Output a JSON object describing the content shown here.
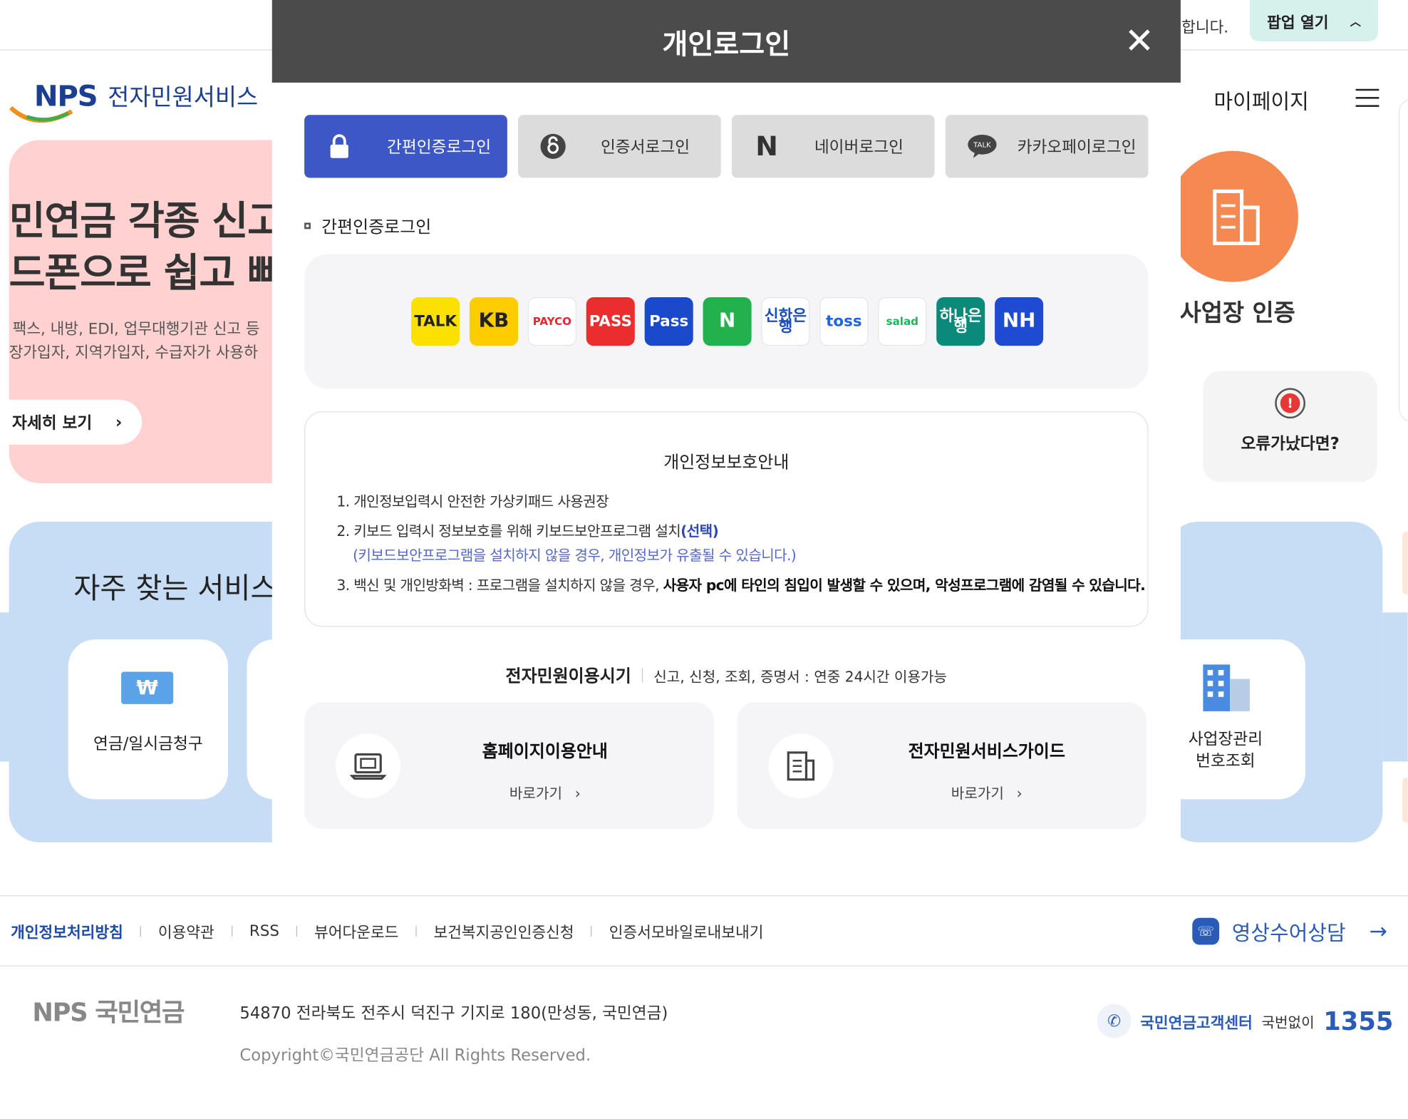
{
  "background": {
    "notice_tail": "합니다.",
    "popup_button": "팝업 열기",
    "logo_mark": "NPS",
    "logo_text": "전자민원서비스",
    "mypage": "마이페이지",
    "banner_line1": "민연금 각종 신고",
    "banner_line2": "드폰으로 쉽고 빠",
    "banner_desc1": "팩스, 내방, EDI, 업무대행기관 신고 등",
    "banner_desc2": "장가입자, 지역가입자, 수급자가 사용하",
    "banner_more": "자세히 보기",
    "freq_title": "자주 찾는 서비스",
    "card_pension_icon": "₩",
    "card_pension": "연금/일시금청구",
    "biz_auth": "사업장 인증",
    "error_label": "오류가났다면?",
    "card_biz_line1": "사업장관리",
    "card_biz_line2": "번호조회"
  },
  "footer": {
    "links": [
      "개인정보처리방침",
      "이용약관",
      "RSS",
      "뷰어다운로드",
      "보건복지공인인증신청",
      "인증서모바일로내보내기"
    ],
    "video": "영상수어상담",
    "logo": "NPS 국민연금",
    "address": "54870 전라북도 전주시 덕진구 기지로 180(만성동, 국민연금)",
    "copyright": "Copyright©국민연금공단 All Rights Reserved.",
    "center": "국민연금고객센터",
    "no_dial": "국번없이",
    "number": "1355"
  },
  "modal": {
    "title": "개인로그인",
    "tabs": [
      "간편인증로그인",
      "인증서로그인",
      "네이버로그인",
      "카카오페이로그인"
    ],
    "section_title": "간편인증로그인",
    "providers": [
      {
        "name": "카카오톡",
        "label": "TALK",
        "color": "#fae100"
      },
      {
        "name": "KB국민은행",
        "label": "KB",
        "color": "#ffcc00"
      },
      {
        "name": "페이코",
        "label": "PAYCO",
        "color": "#ffffff"
      },
      {
        "name": "PASS",
        "label": "PASS",
        "color": "#ea2e2e"
      },
      {
        "name": "삼성패스",
        "label": "Pass",
        "color": "#1a49cc"
      },
      {
        "name": "네이버",
        "label": "N",
        "color": "#22b14c"
      },
      {
        "name": "신한은행",
        "label": "신한은행",
        "color": "#ffffff"
      },
      {
        "name": "토스",
        "label": "toss",
        "color": "#ffffff"
      },
      {
        "name": "뱅크샐러드",
        "label": "salad",
        "color": "#ffffff"
      },
      {
        "name": "하나은행",
        "label": "하나은행",
        "color": "#0b8a7a"
      },
      {
        "name": "NH인증서",
        "label": "NH",
        "color": "#1f4bd2"
      }
    ],
    "notice_title": "개인정보보호안내",
    "notice": {
      "item1": "1.  개인정보입력시 안전한 가상키패드 사용권장",
      "item2": "2.  키보드 입력시 정보보호를 위해 키보드보안프로그램 설치",
      "item2_emph": "(선택)",
      "item2_sub": "(키보드보안프로그램을 설치하지 않을 경우, 개인정보가 유출될 수 있습니다.)",
      "item3": "3.  백신 및 개인방화벽 : 프로그램을 설치하지 않을 경우, ",
      "item3_bold": "사용자 pc에 타인의 침입이 발생할 수 있으며, 악성프로그램에 감염될 수 있습니다."
    },
    "hours_label": "전자민원이용시기",
    "hours_value": "신고, 신청, 조회, 증명서 : 연중 24시간 이용가능",
    "guides": [
      {
        "title": "홈페이지이용안내",
        "link": "바로가기"
      },
      {
        "title": "전자민원서비스가이드",
        "link": "바로가기"
      }
    ]
  }
}
